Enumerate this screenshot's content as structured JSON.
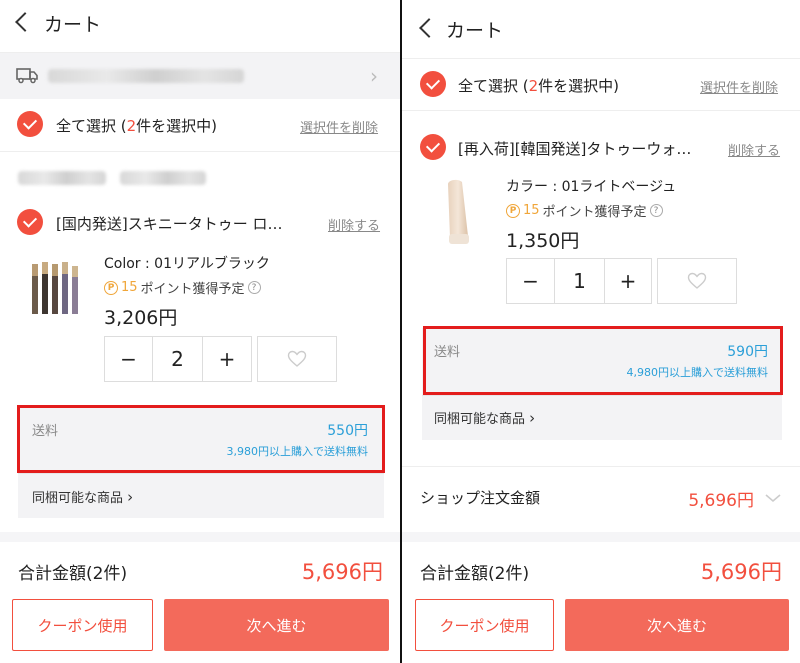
{
  "left": {
    "header_title": "カート",
    "select_all_label": "全て選択 (",
    "select_count": "2",
    "select_suffix": "件を選択中)",
    "delete_selected": "選択件を削除",
    "product": {
      "title": "[国内発送]スキニータトゥー ロ…",
      "delete": "削除する",
      "variant": "Color : 01リアルブラック",
      "points_num": "15",
      "points_text": "ポイント獲得予定",
      "price": "3,206円",
      "quantity": "2"
    },
    "shipping": {
      "label": "送料",
      "fee": "550円",
      "note": "3,980円以上購入で送料無料"
    },
    "bundle_label": "同梱可能な商品",
    "total_label": "合計金額(2件)",
    "total_value": "5,696円",
    "coupon_button": "クーポン使用",
    "next_button": "次へ進む"
  },
  "right": {
    "header_title": "カート",
    "select_all_label": "全て選択 (",
    "select_count": "2",
    "select_suffix": "件を選択中)",
    "delete_selected": "選択件を削除",
    "product": {
      "title": "[再入荷][韓国発送]タトゥーウォ…",
      "delete": "削除する",
      "variant": "カラー : 01ライトベージュ",
      "points_num": "15",
      "points_text": "ポイント獲得予定",
      "price": "1,350円",
      "quantity": "1"
    },
    "shipping": {
      "label": "送料",
      "fee": "590円",
      "note": "4,980円以上購入で送料無料"
    },
    "bundle_label": "同梱可能な商品",
    "shop_total_label": "ショップ注文金額",
    "shop_total_value": "5,696円",
    "total_label": "合計金額(2件)",
    "total_value": "5,696円",
    "coupon_button": "クーポン使用",
    "next_button": "次へ進む"
  },
  "symbols": {
    "minus": "−",
    "plus": "+",
    "question": "?",
    "p_mark": "P",
    "chevron_right": "›"
  },
  "colors": {
    "accent_red": "#f24f3e",
    "button_red": "#f36a5b",
    "shipping_blue": "#2b9fd8",
    "points_orange": "#f0a63a",
    "highlight_red": "#e31c1c"
  }
}
